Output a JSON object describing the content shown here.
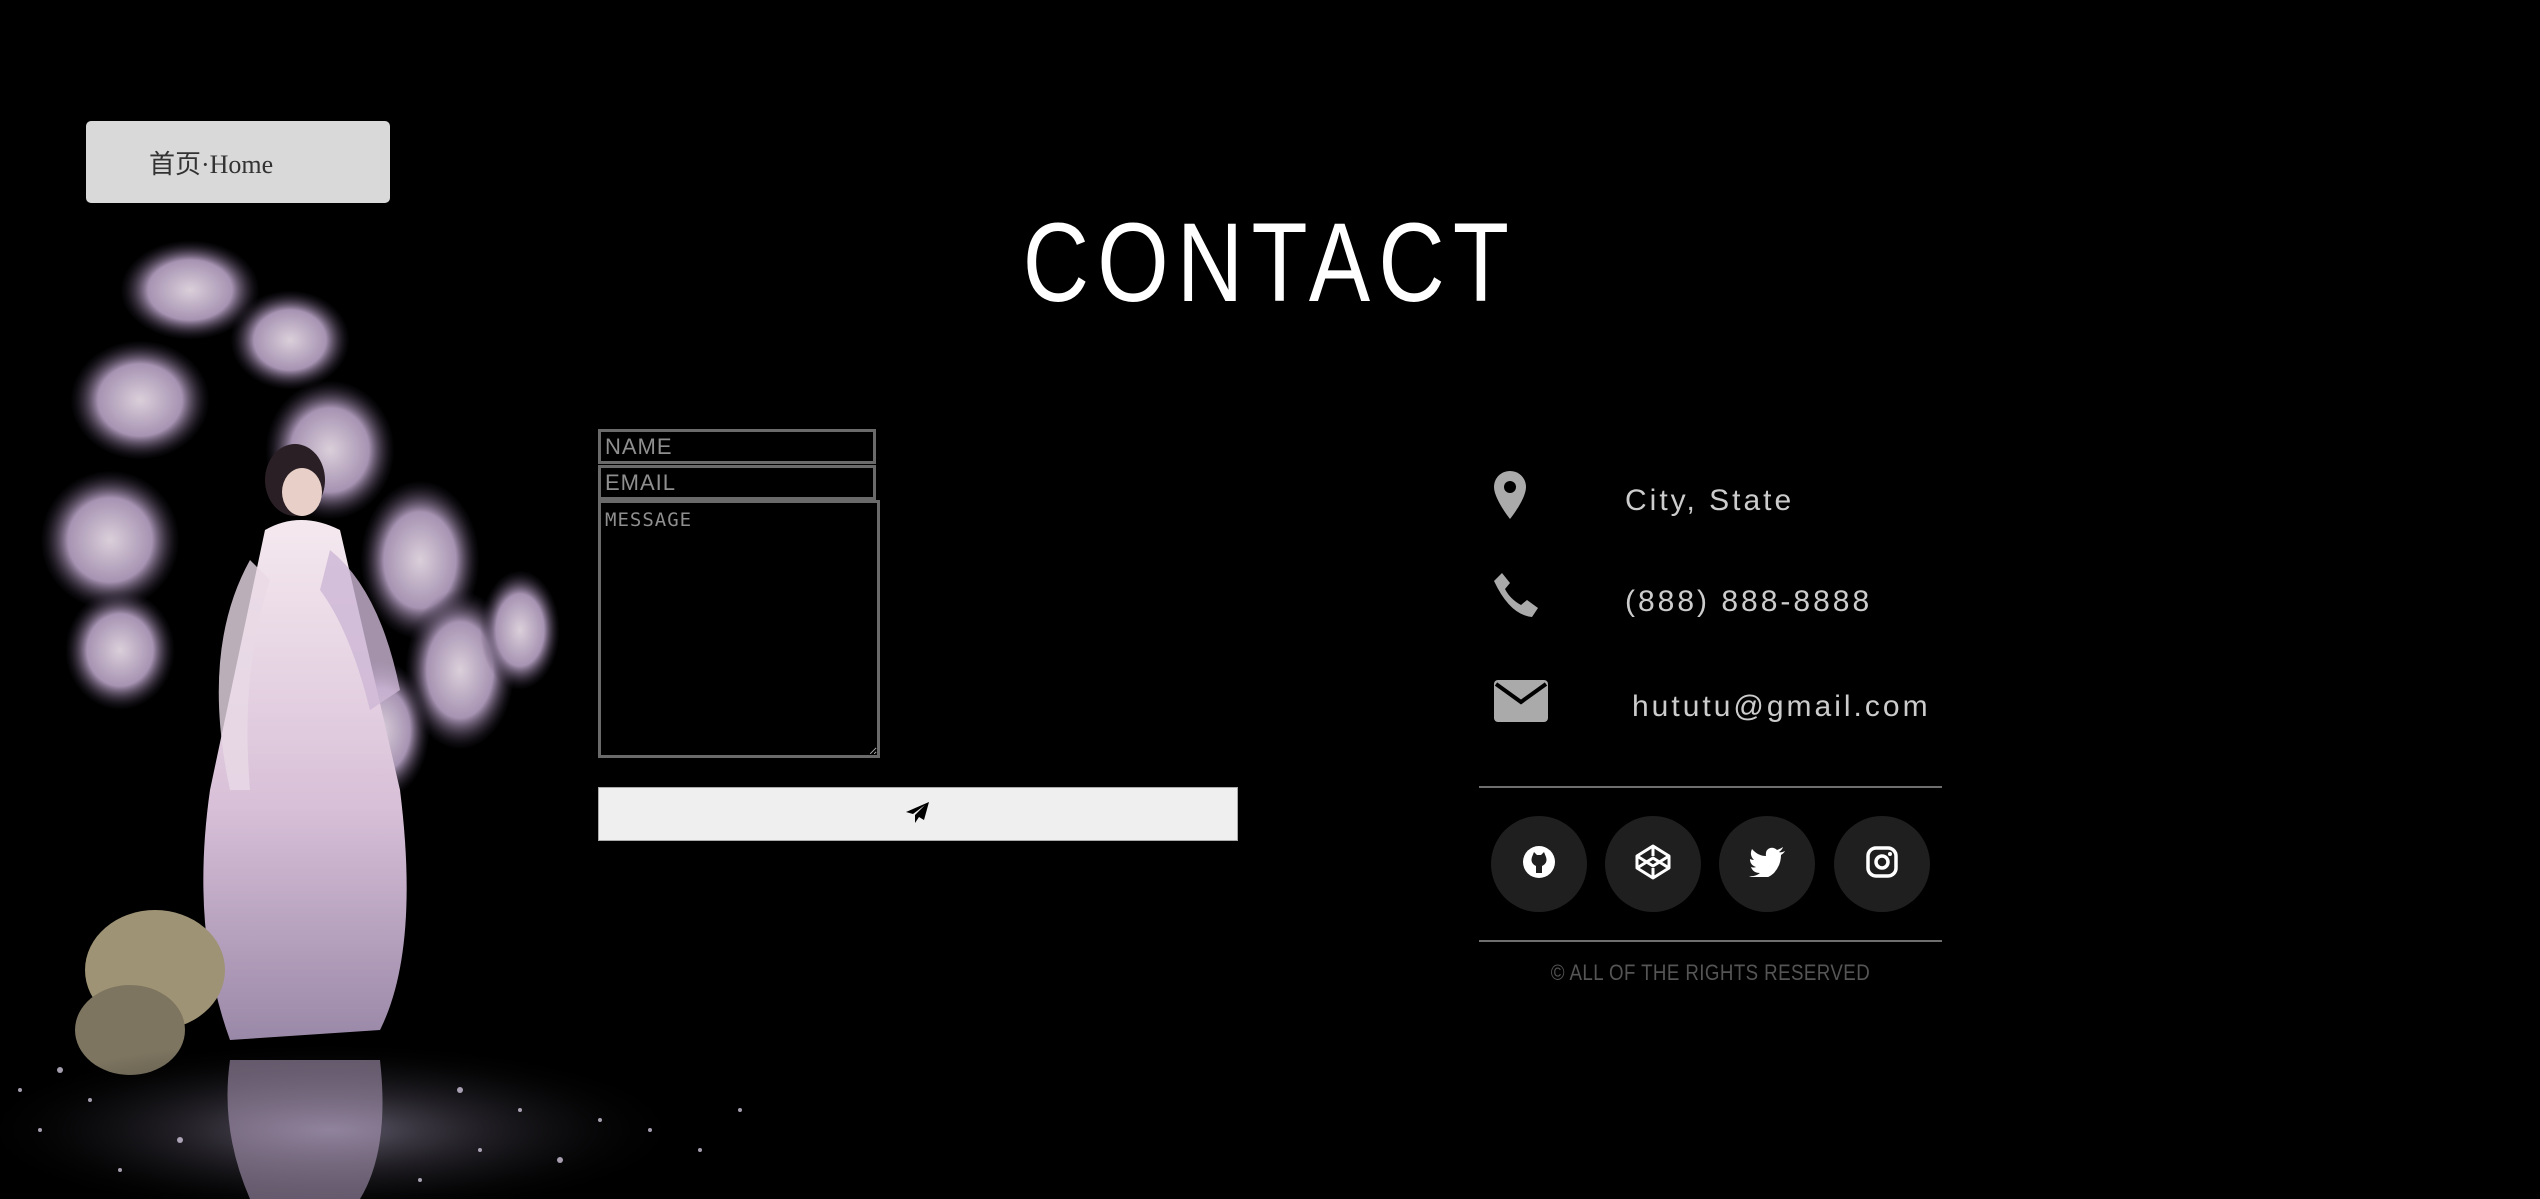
{
  "nav": {
    "home_label": "首页·Home"
  },
  "page": {
    "title": "CONTACT"
  },
  "form": {
    "name_placeholder": "NAME",
    "email_placeholder": "EMAIL",
    "message_placeholder": "MESSAGE",
    "send_icon": "paper-plane-icon"
  },
  "contact_info": [
    {
      "icon": "map-marker-icon",
      "text": "City, State"
    },
    {
      "icon": "phone-icon",
      "text": "(888) 888-8888"
    },
    {
      "icon": "envelope-icon",
      "text": "hututu@gmail.com"
    }
  ],
  "social_links": [
    {
      "icon": "github-icon"
    },
    {
      "icon": "codepen-icon"
    },
    {
      "icon": "twitter-icon"
    },
    {
      "icon": "instagram-icon"
    }
  ],
  "footer": {
    "copyright": "© ALL OF THE RIGHTS RESERVED"
  },
  "colors": {
    "background": "#000000",
    "button": "#d9d9d9",
    "icon": "#aaaaaa",
    "social_bg": "#1f1f1f"
  }
}
